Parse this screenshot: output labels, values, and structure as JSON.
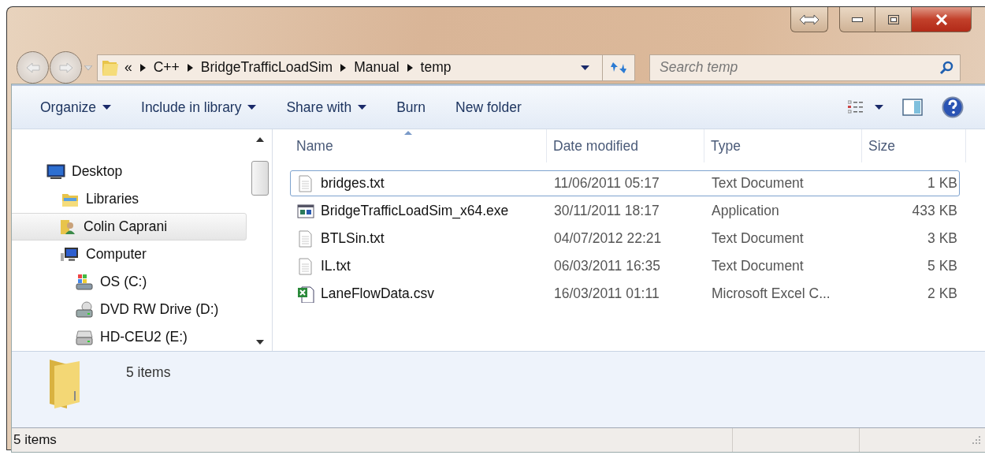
{
  "address_bar": {
    "overflow": "«",
    "crumbs": [
      "C++",
      "BridgeTrafficLoadSim",
      "Manual",
      "temp"
    ]
  },
  "search": {
    "placeholder": "Search temp"
  },
  "toolbar": {
    "buttons": [
      {
        "label": "Organize",
        "dropdown": true
      },
      {
        "label": "Include in library",
        "dropdown": true
      },
      {
        "label": "Share with",
        "dropdown": true
      },
      {
        "label": "Burn",
        "dropdown": false
      },
      {
        "label": "New folder",
        "dropdown": false
      }
    ]
  },
  "sidebar": {
    "items": [
      {
        "label": "Desktop",
        "kind": "desktop",
        "selected": false,
        "children": [
          {
            "label": "Libraries",
            "kind": "libraries",
            "selected": false
          },
          {
            "label": "Colin Caprani",
            "kind": "user",
            "selected": true
          },
          {
            "label": "Computer",
            "kind": "computer",
            "selected": false,
            "children": [
              {
                "label": "OS (C:)",
                "kind": "osdrive",
                "selected": false
              },
              {
                "label": "DVD RW Drive (D:)",
                "kind": "dvd",
                "selected": false
              },
              {
                "label": "HD-CEU2 (E:)",
                "kind": "drive",
                "selected": false
              }
            ]
          }
        ]
      }
    ]
  },
  "table": {
    "columns": [
      {
        "label": "Name",
        "sorted": true
      },
      {
        "label": "Date modified",
        "sorted": false
      },
      {
        "label": "Type",
        "sorted": false
      },
      {
        "label": "Size",
        "sorted": false
      }
    ],
    "rows": [
      {
        "kind": "text",
        "name": "bridges.txt",
        "date": "11/06/2011 05:17",
        "type": "Text Document",
        "size": "1 KB",
        "focused": true
      },
      {
        "kind": "app",
        "name": "BridgeTrafficLoadSim_x64.exe",
        "date": "30/11/2011 18:17",
        "type": "Application",
        "size": "433 KB",
        "focused": false
      },
      {
        "kind": "text",
        "name": "BTLSin.txt",
        "date": "04/07/2012 22:21",
        "type": "Text Document",
        "size": "3 KB",
        "focused": false
      },
      {
        "kind": "text",
        "name": "IL.txt",
        "date": "06/03/2011 16:35",
        "type": "Text Document",
        "size": "5 KB",
        "focused": false
      },
      {
        "kind": "excel",
        "name": "LaneFlowData.csv",
        "date": "16/03/2011 01:11",
        "type": "Microsoft Excel C...",
        "size": "2 KB",
        "focused": false
      }
    ]
  },
  "details_pane": {
    "count": "5 items"
  },
  "status_bar": {
    "text": "5 items"
  }
}
